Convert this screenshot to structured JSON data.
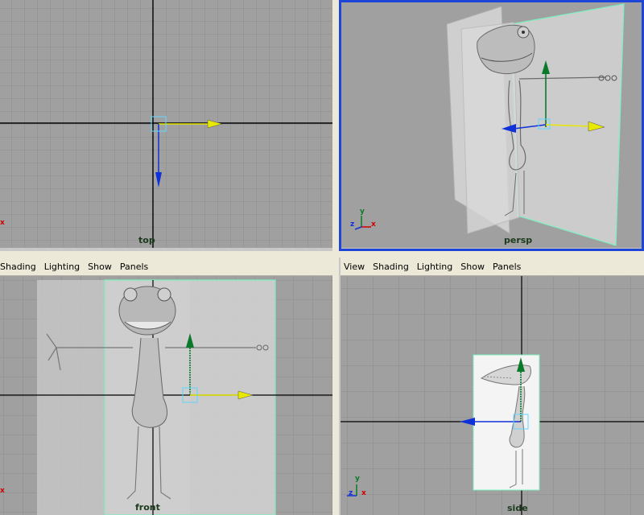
{
  "panels": {
    "top": {
      "label": "top"
    },
    "persp": {
      "label": "persp"
    },
    "front": {
      "label": "front",
      "menu": [
        "Shading",
        "Lighting",
        "Show",
        "Panels"
      ]
    },
    "side": {
      "label": "side",
      "menu": [
        "View",
        "Shading",
        "Lighting",
        "Show",
        "Panels"
      ]
    }
  },
  "axis_letters": {
    "x": "x",
    "y": "y",
    "z": "z"
  },
  "colors": {
    "viewport_bg": "#a0a0a0",
    "grid_line": "#8a8a8a",
    "axis_line": "#000000",
    "active_border": "#1e44d8",
    "move_x_arrow": "#e8e800",
    "move_y_arrow": "#0a7a2a",
    "move_z_arrow": "#1030d8",
    "plane_outline": "#7ef0c0"
  }
}
